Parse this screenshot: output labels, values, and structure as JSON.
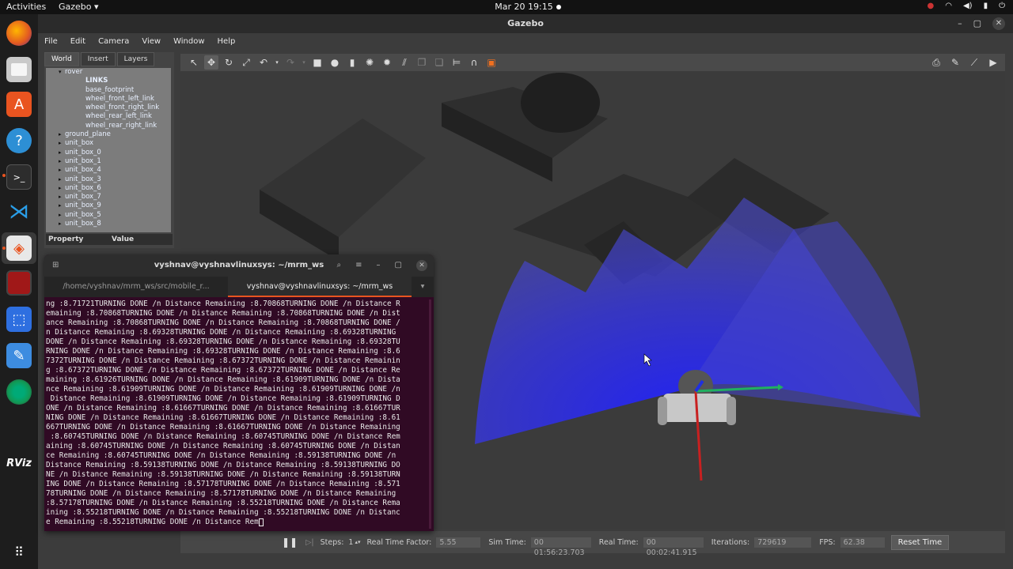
{
  "topbar": {
    "activities": "Activities",
    "app_menu": "Gazebo ▾",
    "clock": "Mar 20  19:15"
  },
  "dock": {
    "items": [
      "firefox-icon",
      "files-icon",
      "app-store-icon",
      "help-icon",
      "terminal-icon",
      "vscode-icon",
      "gazebo-icon",
      "terminal-red-icon",
      "screenshot-icon",
      "text-editor-icon",
      "chrome-icon",
      "rviz-icon",
      "show-apps-icon"
    ],
    "rviz_label": "RViz"
  },
  "window": {
    "title": "Gazebo",
    "menu": [
      "File",
      "Edit",
      "Camera",
      "View",
      "Window",
      "Help"
    ]
  },
  "left_panel": {
    "tabs": [
      "World",
      "Insert",
      "Layers"
    ],
    "active_tab": "World",
    "tree": [
      {
        "label": "rover",
        "indent": 1,
        "arrow": "▾"
      },
      {
        "label": "LINKS",
        "indent": 2,
        "arrow": ""
      },
      {
        "label": "base_footprint",
        "indent": 2,
        "arrow": ""
      },
      {
        "label": "wheel_front_left_link",
        "indent": 2,
        "arrow": ""
      },
      {
        "label": "wheel_front_right_link",
        "indent": 2,
        "arrow": ""
      },
      {
        "label": "wheel_rear_left_link",
        "indent": 2,
        "arrow": ""
      },
      {
        "label": "wheel_rear_right_link",
        "indent": 2,
        "arrow": ""
      },
      {
        "label": "ground_plane",
        "indent": 1,
        "arrow": "▸"
      },
      {
        "label": "unit_box",
        "indent": 1,
        "arrow": "▸"
      },
      {
        "label": "unit_box_0",
        "indent": 1,
        "arrow": "▸"
      },
      {
        "label": "unit_box_1",
        "indent": 1,
        "arrow": "▸"
      },
      {
        "label": "unit_box_4",
        "indent": 1,
        "arrow": "▸"
      },
      {
        "label": "unit_box_3",
        "indent": 1,
        "arrow": "▸"
      },
      {
        "label": "unit_box_6",
        "indent": 1,
        "arrow": "▸"
      },
      {
        "label": "unit_box_7",
        "indent": 1,
        "arrow": "▸"
      },
      {
        "label": "unit_box_9",
        "indent": 1,
        "arrow": "▸"
      },
      {
        "label": "unit_box_5",
        "indent": 1,
        "arrow": "▸"
      },
      {
        "label": "unit_box_8",
        "indent": 1,
        "arrow": "▸"
      }
    ],
    "property_header": "Property",
    "value_header": "Value"
  },
  "toolbar": {
    "left": [
      "select-arrow-icon",
      "translate-icon",
      "rotate-icon",
      "scale-icon",
      "undo-icon",
      "undo-dropdown-icon",
      "redo-icon",
      "redo-dropdown-icon",
      "box-icon",
      "sphere-icon",
      "cylinder-icon",
      "point-light-icon",
      "spot-light-icon",
      "directional-light-icon",
      "copy-icon",
      "paste-icon",
      "align-icon",
      "snap-icon",
      "view-angle-icon"
    ],
    "right": [
      "screenshot-icon",
      "log-icon",
      "plot-icon",
      "video-icon"
    ]
  },
  "bottom": {
    "steps_label": "Steps:",
    "steps_value": "1",
    "rtf_label": "Real Time Factor:",
    "rtf_value": "5.55",
    "sim_time_label": "Sim Time:",
    "sim_time_value": "00 01:56:23.703",
    "real_time_label": "Real Time:",
    "real_time_value": "00 00:02:41.915",
    "iterations_label": "Iterations:",
    "iterations_value": "729619",
    "fps_label": "FPS:",
    "fps_value": "62.38",
    "reset_label": "Reset Time"
  },
  "terminal": {
    "title": "vyshnav@vyshnavlinuxsys: ~/mrm_ws",
    "tabs": [
      "/home/vyshnav/mrm_ws/src/mobile_r...",
      "vyshnav@vyshnavlinuxsys: ~/mrm_ws"
    ],
    "lines": [
      "ng :8.71721TURNING DONE /n Distance Remaining :8.70868TURNING DONE /n Distance R",
      "emaining :8.70868TURNING DONE /n Distance Remaining :8.70868TURNING DONE /n Dist",
      "ance Remaining :8.70868TURNING DONE /n Distance Remaining :8.70868TURNING DONE /",
      "n Distance Remaining :8.69328TURNING DONE /n Distance Remaining :8.69328TURNING ",
      "DONE /n Distance Remaining :8.69328TURNING DONE /n Distance Remaining :8.69328TU",
      "RNING DONE /n Distance Remaining :8.69328TURNING DONE /n Distance Remaining :8.6",
      "7372TURNING DONE /n Distance Remaining :8.67372TURNING DONE /n Distance Remainin",
      "g :8.67372TURNING DONE /n Distance Remaining :8.67372TURNING DONE /n Distance Re",
      "maining :8.61926TURNING DONE /n Distance Remaining :8.61909TURNING DONE /n Dista",
      "nce Remaining :8.61909TURNING DONE /n Distance Remaining :8.61909TURNING DONE /n",
      " Distance Remaining :8.61909TURNING DONE /n Distance Remaining :8.61909TURNING D",
      "ONE /n Distance Remaining :8.61667TURNING DONE /n Distance Remaining :8.61667TUR",
      "NING DONE /n Distance Remaining :8.61667TURNING DONE /n Distance Remaining :8.61",
      "667TURNING DONE /n Distance Remaining :8.61667TURNING DONE /n Distance Remaining",
      " :8.60745TURNING DONE /n Distance Remaining :8.60745TURNING DONE /n Distance Rem",
      "aining :8.60745TURNING DONE /n Distance Remaining :8.60745TURNING DONE /n Distan",
      "ce Remaining :8.60745TURNING DONE /n Distance Remaining :8.59138TURNING DONE /n ",
      "Distance Remaining :8.59138TURNING DONE /n Distance Remaining :8.59138TURNING DO",
      "NE /n Distance Remaining :8.59138TURNING DONE /n Distance Remaining :8.59138TURN",
      "ING DONE /n Distance Remaining :8.57178TURNING DONE /n Distance Remaining :8.571",
      "78TURNING DONE /n Distance Remaining :8.57178TURNING DONE /n Distance Remaining ",
      ":8.57178TURNING DONE /n Distance Remaining :8.55218TURNING DONE /n Distance Rema",
      "ining :8.55218TURNING DONE /n Distance Remaining :8.55218TURNING DONE /n Distanc",
      "e Remaining :8.55218TURNING DONE /n Distance Rem"
    ]
  },
  "colors": {
    "laser": "#3030e0",
    "terminal_bg": "#300a24",
    "accent": "#e95420"
  }
}
